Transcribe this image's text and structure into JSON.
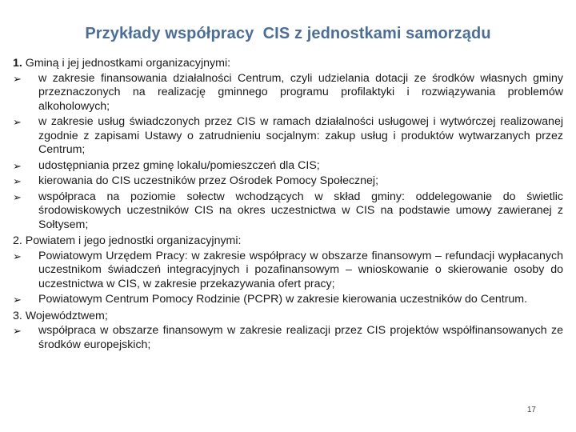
{
  "title": "Przykłady współpracy  CIS z jednostkami samorządu",
  "bullet_icon": "➢",
  "sections": [
    {
      "number": "1.",
      "heading": " Gminą i jej jednostkami organizacyjnymi:",
      "items": [
        " w zakresie finansowania działalności Centrum, czyli udzielania dotacji ze środków własnych gminy przeznaczonych na realizację gminnego programu profilaktyki i rozwiązywania problemów alkoholowych;",
        " w zakresie usług świadczonych przez CIS w ramach działalności usługowej i wytwórczej realizowanej zgodnie z zapisami Ustawy o zatrudnieniu socjalnym: zakup usług i produktów wytwarzanych przez Centrum;",
        " udostępniania przez gminę lokalu/pomieszczeń dla CIS;",
        "kierowania do CIS uczestników przez Ośrodek Pomocy Społecznej;",
        " współpraca na poziomie sołectw wchodzących w skład gminy: oddelegowanie do świetlic środowiskowych uczestników CIS na okres uczestnictwa w CIS na podstawie umowy zawieranej z Sołtysem;"
      ]
    },
    {
      "number": "2.",
      "heading": " Powiatem i jego jednostki organizacyjnymi:",
      "items": [
        "Powiatowym Urzędem Pracy: w zakresie współpracy w obszarze finansowym – refundacji wypłacanych uczestnikom świadczeń integracyjnych i pozafinansowym – wnioskowanie o skierowanie osoby do uczestnictwa w CIS, w zakresie przekazywania ofert pracy;",
        " Powiatowym Centrum Pomocy Rodzinie (PCPR) w zakresie kierowania uczestników do Centrum."
      ]
    },
    {
      "number": "3.",
      "heading": " Województwem;",
      "items": [
        "współpraca w obszarze finansowym w zakresie realizacji przez CIS projektów współfinansowanych ze środków europejskich;"
      ]
    }
  ],
  "page_number": "17"
}
